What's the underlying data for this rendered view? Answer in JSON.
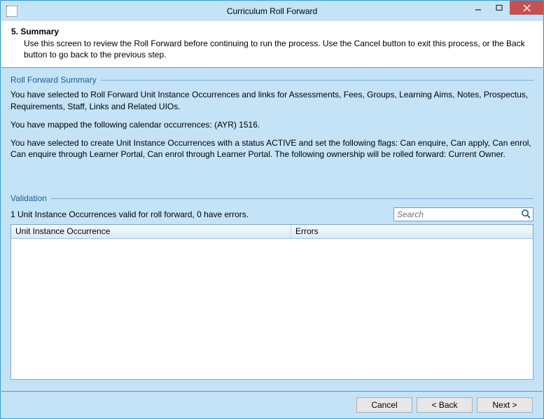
{
  "window": {
    "title": "Curriculum Roll Forward"
  },
  "header": {
    "step_title": "5. Summary",
    "description": "Use this screen to review the Roll Forward before continuing to run the process.  Use the Cancel button to exit this process, or the Back button to go back to the previous step."
  },
  "summary": {
    "group_label": "Roll Forward Summary",
    "paragraph1": "You have selected to Roll Forward Unit Instance Occurrences and links for Assessments, Fees, Groups, Learning Aims, Notes, Prospectus, Requirements, Staff, Links and Related UIOs.",
    "paragraph2": "You have mapped the following calendar occurrences: (AYR) 1516.",
    "paragraph3": "You have selected to create Unit Instance Occurrences with a status ACTIVE and set the following flags: Can enquire, Can apply, Can enrol, Can enquire through Learner Portal, Can enrol through Learner Portal. The following ownership will be rolled forward: Current Owner."
  },
  "validation": {
    "group_label": "Validation",
    "status_text": "1 Unit Instance Occurrences valid for roll forward, 0 have errors.",
    "search_placeholder": "Search",
    "columns": {
      "col1": "Unit Instance Occurrence",
      "col2": "Errors"
    },
    "rows": []
  },
  "buttons": {
    "cancel": "Cancel",
    "back": "< Back",
    "next": "Next >"
  }
}
